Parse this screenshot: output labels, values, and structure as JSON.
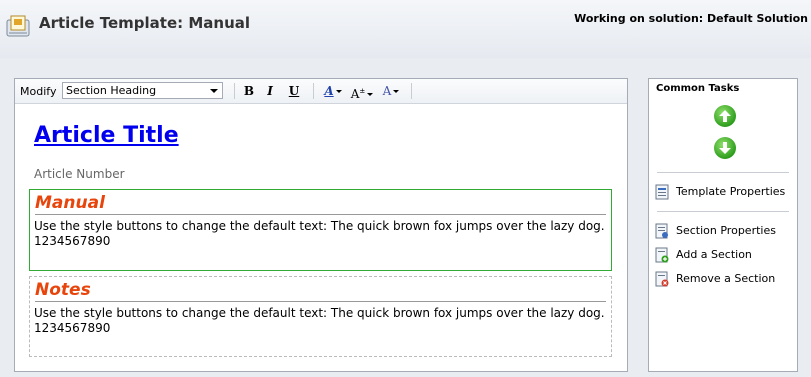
{
  "header": {
    "title": "Article Template: Manual",
    "solution_text": "Working on solution: Default Solution",
    "icon": "article-template-icon"
  },
  "toolbar": {
    "modify_label": "Modify",
    "style_select_value": "Section Heading",
    "bold_label": "B",
    "italic_label": "I",
    "underline_label": "U",
    "font_label": "A",
    "font_size_label": "A",
    "font_color_label": "A"
  },
  "content": {
    "article_title": "Article Title",
    "article_number": "Article Number",
    "sections": [
      {
        "heading": "Manual",
        "text": "Use the style buttons to change the default text: The quick brown fox jumps over the lazy dog. 1234567890",
        "selected": true
      },
      {
        "heading": "Notes",
        "text": "Use the style buttons to change the default text: The quick brown fox jumps over the lazy dog. 1234567890",
        "selected": false
      }
    ]
  },
  "tasks": {
    "title": "Common Tasks",
    "move_up_icon": "move-up-icon",
    "move_down_icon": "move-down-icon",
    "items": [
      {
        "label": "Template Properties",
        "icon": "template-properties-icon"
      },
      {
        "label": "Section Properties",
        "icon": "section-properties-icon"
      },
      {
        "label": "Add a Section",
        "icon": "add-section-icon"
      },
      {
        "label": "Remove a Section",
        "icon": "remove-section-icon"
      }
    ]
  },
  "colors": {
    "heading_color": "#e8450c",
    "title_link_color": "#0000ee",
    "selected_section_border": "#33aa33"
  }
}
